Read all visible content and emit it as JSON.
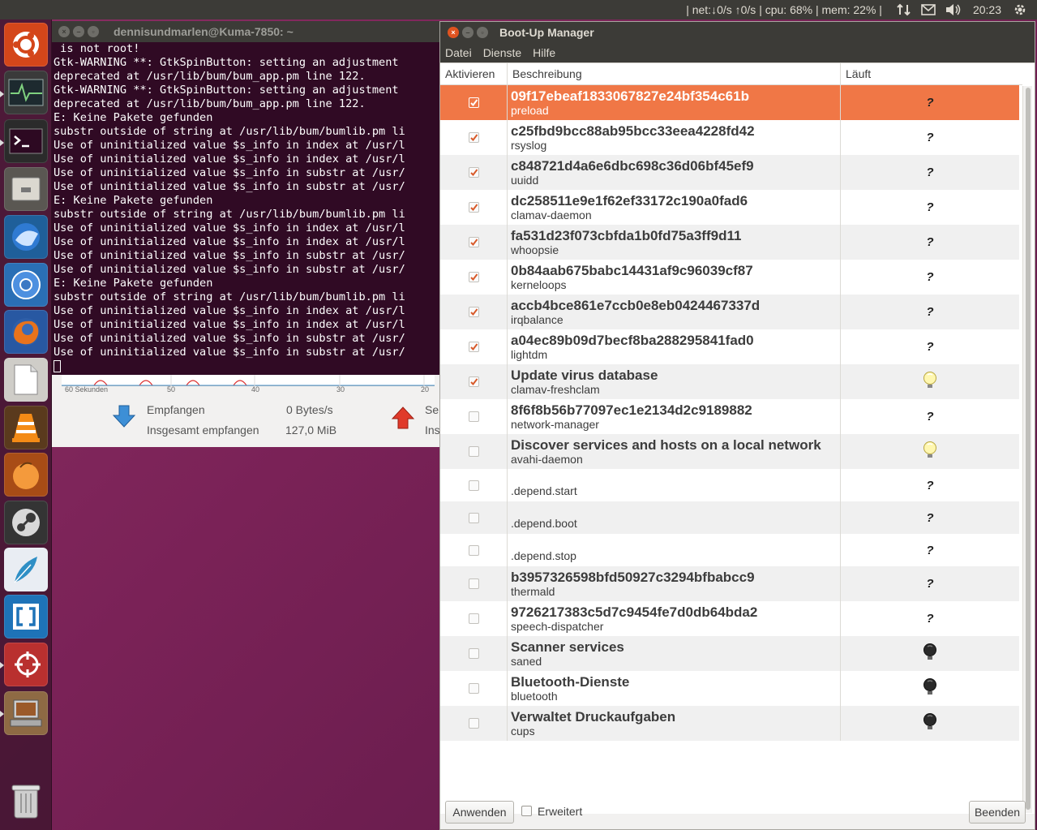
{
  "top_panel": {
    "sysmon_text": "| net:↓0/s ↑0/s | cpu: 68% | mem: 22% |",
    "clock": "20:23"
  },
  "launcher": {
    "items": [
      "ubuntu-dash",
      "system-monitor",
      "terminal",
      "files",
      "thunderbird",
      "chromium",
      "firefox",
      "libreoffice",
      "vlc",
      "clementine",
      "steam",
      "scribus",
      "brackets",
      "screenshot-tool",
      "workspace-switcher"
    ]
  },
  "terminal": {
    "title": "dennisundmarlen@Kuma-7850: ~",
    "lines": [
      " is not root!",
      "Gtk-WARNING **: GtkSpinButton: setting an adjustment",
      "deprecated at /usr/lib/bum/bum_app.pm line 122.",
      "Gtk-WARNING **: GtkSpinButton: setting an adjustment",
      "deprecated at /usr/lib/bum/bum_app.pm line 122.",
      "E: Keine Pakete gefunden",
      "substr outside of string at /usr/lib/bum/bumlib.pm li",
      "Use of uninitialized value $s_info in index at /usr/l",
      "Use of uninitialized value $s_info in index at /usr/l",
      "Use of uninitialized value $s_info in substr at /usr/",
      "Use of uninitialized value $s_info in substr at /usr/",
      "E: Keine Pakete gefunden",
      "substr outside of string at /usr/lib/bum/bumlib.pm li",
      "Use of uninitialized value $s_info in index at /usr/l",
      "Use of uninitialized value $s_info in index at /usr/l",
      "Use of uninitialized value $s_info in substr at /usr/",
      "Use of uninitialized value $s_info in substr at /usr/",
      "E: Keine Pakete gefunden",
      "substr outside of string at /usr/lib/bum/bumlib.pm li",
      "Use of uninitialized value $s_info in index at /usr/l",
      "Use of uninitialized value $s_info in index at /usr/l",
      "Use of uninitialized value $s_info in substr at /usr/",
      "Use of uninitialized value $s_info in substr at /usr/"
    ]
  },
  "system_monitor": {
    "ticks": [
      "60 Sekunden",
      "50",
      "40",
      "30",
      "20"
    ],
    "received_label": "Empfangen",
    "received_value": "0 Bytes/s",
    "total_received_label": "Insgesamt empfangen",
    "total_received_value": "127,0 MiB",
    "sent_label_partial": "Se",
    "total_sent_label_partial": "Ins"
  },
  "bum": {
    "title": "Boot-Up Manager",
    "menu": [
      "Datei",
      "Dienste",
      "Hilfe"
    ],
    "columns": {
      "activate": "Aktivieren",
      "description": "Beschreibung",
      "running": "Läuft"
    },
    "rows": [
      {
        "title": "09f17ebeaf1833067827e24bf354c61b",
        "name": "preload",
        "active": true,
        "running": "?",
        "selected": true
      },
      {
        "title": "c25fbd9bcc88ab95bcc33eea4228fd42",
        "name": "rsyslog",
        "active": true,
        "running": "?"
      },
      {
        "title": "c848721d4a6e6dbc698c36d06bf45ef9",
        "name": "uuidd",
        "active": true,
        "running": "?"
      },
      {
        "title": "dc258511e9e1f62ef33172c190a0fad6",
        "name": "clamav-daemon",
        "active": true,
        "running": "?"
      },
      {
        "title": "fa531d23f073cbfda1b0fd75a3ff9d11",
        "name": "whoopsie",
        "active": true,
        "running": "?"
      },
      {
        "title": "0b84aab675babc14431af9c96039cf87",
        "name": "kerneloops",
        "active": true,
        "running": "?"
      },
      {
        "title": "accb4bce861e7ccb0e8eb0424467337d",
        "name": "irqbalance",
        "active": true,
        "running": "?"
      },
      {
        "title": "a04ec89b09d7becf8ba288295841fad0",
        "name": "lightdm",
        "active": true,
        "running": "?"
      },
      {
        "title": "Update virus database",
        "name": "clamav-freshclam",
        "active": true,
        "running": "bulb-on"
      },
      {
        "title": "8f6f8b56b77097ec1e2134d2c9189882",
        "name": "network-manager",
        "active": false,
        "running": "?"
      },
      {
        "title": "Discover services and hosts on a local network",
        "name": "avahi-daemon",
        "active": false,
        "running": "bulb-on"
      },
      {
        "title": "",
        "name": ".depend.start",
        "active": false,
        "running": "?"
      },
      {
        "title": "",
        "name": ".depend.boot",
        "active": false,
        "running": "?"
      },
      {
        "title": "",
        "name": ".depend.stop",
        "active": false,
        "running": "?"
      },
      {
        "title": "b3957326598bfd50927c3294bfbabcc9",
        "name": "thermald",
        "active": false,
        "running": "?"
      },
      {
        "title": "9726217383c5d7c9454fe7d0db64bda2",
        "name": "speech-dispatcher",
        "active": false,
        "running": "?"
      },
      {
        "title": "Scanner services",
        "name": "saned",
        "active": false,
        "running": "bulb-off"
      },
      {
        "title": "Bluetooth-Dienste",
        "name": "bluetooth",
        "active": false,
        "running": "bulb-off"
      },
      {
        "title": "Verwaltet Druckaufgaben",
        "name": "cups",
        "active": false,
        "running": "bulb-off"
      }
    ],
    "buttons": {
      "apply": "Anwenden",
      "advanced": "Erweitert",
      "quit": "Beenden"
    }
  }
}
